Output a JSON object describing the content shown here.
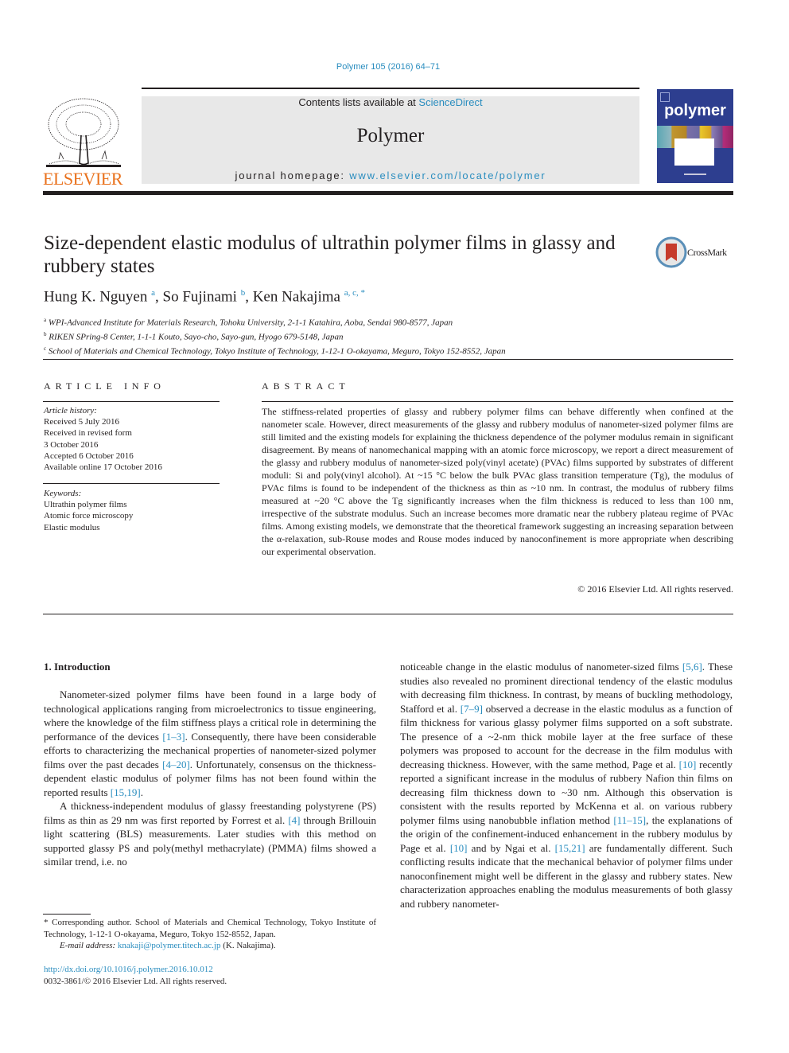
{
  "header": {
    "journal_ref": "Polymer 105 (2016) 64–71",
    "publisher_logo_text": "ELSEVIER",
    "contents_prefix": "Contents lists available at ",
    "contents_link": "ScienceDirect",
    "journal_title": "Polymer",
    "homepage_prefix": "journal homepage: ",
    "homepage_link": "www.elsevier.com/locate/polymer",
    "cover_title": "polymer"
  },
  "article": {
    "title": "Size-dependent elastic modulus of ultrathin polymer films in glassy and rubbery states",
    "crossmark_label": "CrossMark",
    "authors": [
      {
        "name": "Hung K. Nguyen",
        "sup": "a",
        "sep": ", "
      },
      {
        "name": "So Fujinami",
        "sup": "b",
        "sep": ", "
      },
      {
        "name": "Ken Nakajima",
        "sup": "a, c, *",
        "sep": ""
      }
    ],
    "affiliations": [
      {
        "sup": "a",
        "text": "WPI-Advanced Institute for Materials Research, Tohoku University, 2-1-1 Katahira, Aoba, Sendai 980-8577, Japan"
      },
      {
        "sup": "b",
        "text": "RIKEN SPring-8 Center, 1-1-1 Kouto, Sayo-cho, Sayo-gun, Hyogo 679-5148, Japan"
      },
      {
        "sup": "c",
        "text": "School of Materials and Chemical Technology, Tokyo Institute of Technology, 1-12-1 O-okayama, Meguro, Tokyo 152-8552, Japan"
      }
    ]
  },
  "article_info": {
    "heading": "ARTICLE INFO",
    "history_label": "Article history:",
    "history": [
      "Received 5 July 2016",
      "Received in revised form",
      "3 October 2016",
      "Accepted 6 October 2016",
      "Available online 17 October 2016"
    ],
    "keywords_label": "Keywords:",
    "keywords": [
      "Ultrathin polymer films",
      "Atomic force microscopy",
      "Elastic modulus"
    ]
  },
  "abstract": {
    "heading": "ABSTRACT",
    "text": "The stiffness-related properties of glassy and rubbery polymer films can behave differently when confined at the nanometer scale. However, direct measurements of the glassy and rubbery modulus of nanometer-sized polymer films are still limited and the existing models for explaining the thickness dependence of the polymer modulus remain in significant disagreement. By means of nanomechanical mapping with an atomic force microscopy, we report a direct measurement of the glassy and rubbery modulus of nanometer-sized poly(vinyl acetate) (PVAc) films supported by substrates of different moduli: Si and poly(vinyl alcohol). At ~15 °C below the bulk PVAc glass transition temperature (Tg), the modulus of PVAc films is found to be independent of the thickness as thin as ~10 nm. In contrast, the modulus of rubbery films measured at ~20 °C above the Tg significantly increases when the film thickness is reduced to less than 100 nm, irrespective of the substrate modulus. Such an increase becomes more dramatic near the rubbery plateau regime of PVAc films. Among existing models, we demonstrate that the theoretical framework suggesting an increasing separation between the α-relaxation, sub-Rouse modes and Rouse modes induced by nanoconfinement is more appropriate when describing our experimental observation.",
    "copyright": "© 2016 Elsevier Ltd. All rights reserved."
  },
  "body": {
    "section_heading": "1.  Introduction",
    "left_paragraphs": [
      [
        {
          "t": "Nanometer-sized polymer films have been found in a large body of technological applications ranging from microelectronics to tissue engineering, where the knowledge of the film stiffness plays a critical role in determining the performance of the devices "
        },
        {
          "ref": "[1–3]"
        },
        {
          "t": ". Consequently, there have been considerable efforts to characterizing the mechanical properties of nanometer-sized polymer films over the past decades "
        },
        {
          "ref": "[4–20]"
        },
        {
          "t": ". Unfortunately, consensus on the thickness-dependent elastic modulus of polymer films has not been found within the reported results "
        },
        {
          "ref": "[15,19]"
        },
        {
          "t": "."
        }
      ],
      [
        {
          "t": "A thickness-independent modulus of glassy freestanding polystyrene (PS) films as thin as 29 nm was first reported by Forrest et al. "
        },
        {
          "ref": "[4]"
        },
        {
          "t": " through Brillouin light scattering (BLS) measurements. Later studies with this method on supported glassy PS and poly(methyl methacrylate) (PMMA) films showed a similar trend, i.e. no"
        }
      ]
    ],
    "right_paragraphs": [
      [
        {
          "t": "noticeable change in the elastic modulus of nanometer-sized films "
        },
        {
          "ref": "[5,6]"
        },
        {
          "t": ". These studies also revealed no prominent directional tendency of the elastic modulus with decreasing film thickness. In contrast, by means of buckling methodology, Stafford et al. "
        },
        {
          "ref": "[7–9]"
        },
        {
          "t": " observed a decrease in the elastic modulus as a function of film thickness for various glassy polymer films supported on a soft substrate. The presence of a ~2-nm thick mobile layer at the free surface of these polymers was proposed to account for the decrease in the film modulus with decreasing thickness. However, with the same method, Page et al. "
        },
        {
          "ref": "[10]"
        },
        {
          "t": " recently reported a significant increase in the modulus of rubbery Nafion thin films on decreasing film thickness down to ~30 nm. Although this observation is consistent with the results reported by McKenna et al. on various rubbery polymer films using nanobubble inflation method "
        },
        {
          "ref": "[11–15]"
        },
        {
          "t": ", the explanations of the origin of the confinement-induced enhancement in the rubbery modulus by Page et al. "
        },
        {
          "ref": "[10]"
        },
        {
          "t": " and by Ngai et al. "
        },
        {
          "ref": "[15,21]"
        },
        {
          "t": " are fundamentally different. Such conflicting results indicate that the mechanical behavior of polymer films under nanoconfinement might well be different in the glassy and rubbery states. New characterization approaches enabling the modulus measurements of both glassy and rubbery nanometer-"
        }
      ]
    ]
  },
  "footnote": {
    "corresponding": "* Corresponding author. School of Materials and Chemical Technology, Tokyo Institute of Technology, 1-12-1 O-okayama, Meguro, Tokyo 152-8552, Japan.",
    "email_label": "E-mail address: ",
    "email": "knakaji@polymer.titech.ac.jp",
    "email_suffix": " (K. Nakajima)."
  },
  "footer": {
    "doi": "http://dx.doi.org/10.1016/j.polymer.2016.10.012",
    "issn": "0032-3861/© 2016 Elsevier Ltd. All rights reserved."
  },
  "colors": {
    "link": "#2a8dbf",
    "elsevier_orange": "#e9711c",
    "banner_bg": "#e8e8e8",
    "cover_blue": "#2d3e8f"
  }
}
